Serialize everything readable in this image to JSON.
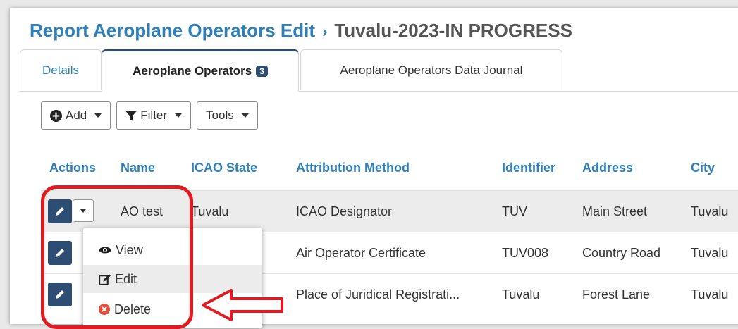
{
  "header": {
    "breadcrumb_parent": "Report Aeroplane Operators Edit",
    "separator": "›",
    "title": "Tuvalu-2023-IN PROGRESS"
  },
  "tabs": [
    {
      "label": "Details"
    },
    {
      "label": "Aeroplane Operators",
      "badge": "3"
    },
    {
      "label": "Aeroplane Operators Data Journal"
    }
  ],
  "toolbar": {
    "add_label": "Add",
    "filter_label": "Filter",
    "tools_label": "Tools"
  },
  "table": {
    "columns": [
      "Actions",
      "Name",
      "ICAO State",
      "Attribution Method",
      "Identifier",
      "Address",
      "City"
    ],
    "rows": [
      {
        "name": "AO test",
        "icao_state": "Tuvalu",
        "attribution_method": "ICAO Designator",
        "identifier": "TUV",
        "address": "Main Street",
        "city": "Tuvalu"
      },
      {
        "name": "",
        "icao_state": "",
        "attribution_method": "Air Operator Certificate",
        "identifier": "TUV008",
        "address": "Country Road",
        "city": "Tuvalu"
      },
      {
        "name": "",
        "icao_state": "",
        "attribution_method": "Place of Juridical Registrati...",
        "identifier": "Tuvalu",
        "address": "Forest Lane",
        "city": "Tuvalu"
      }
    ]
  },
  "row_menu": {
    "view_label": "View",
    "edit_label": "Edit",
    "delete_label": "Delete"
  },
  "colors": {
    "link": "#2f7fb8",
    "primary_button": "#2d4d73",
    "annotation": "#e11b22",
    "delete_icon": "#e74c3c"
  }
}
